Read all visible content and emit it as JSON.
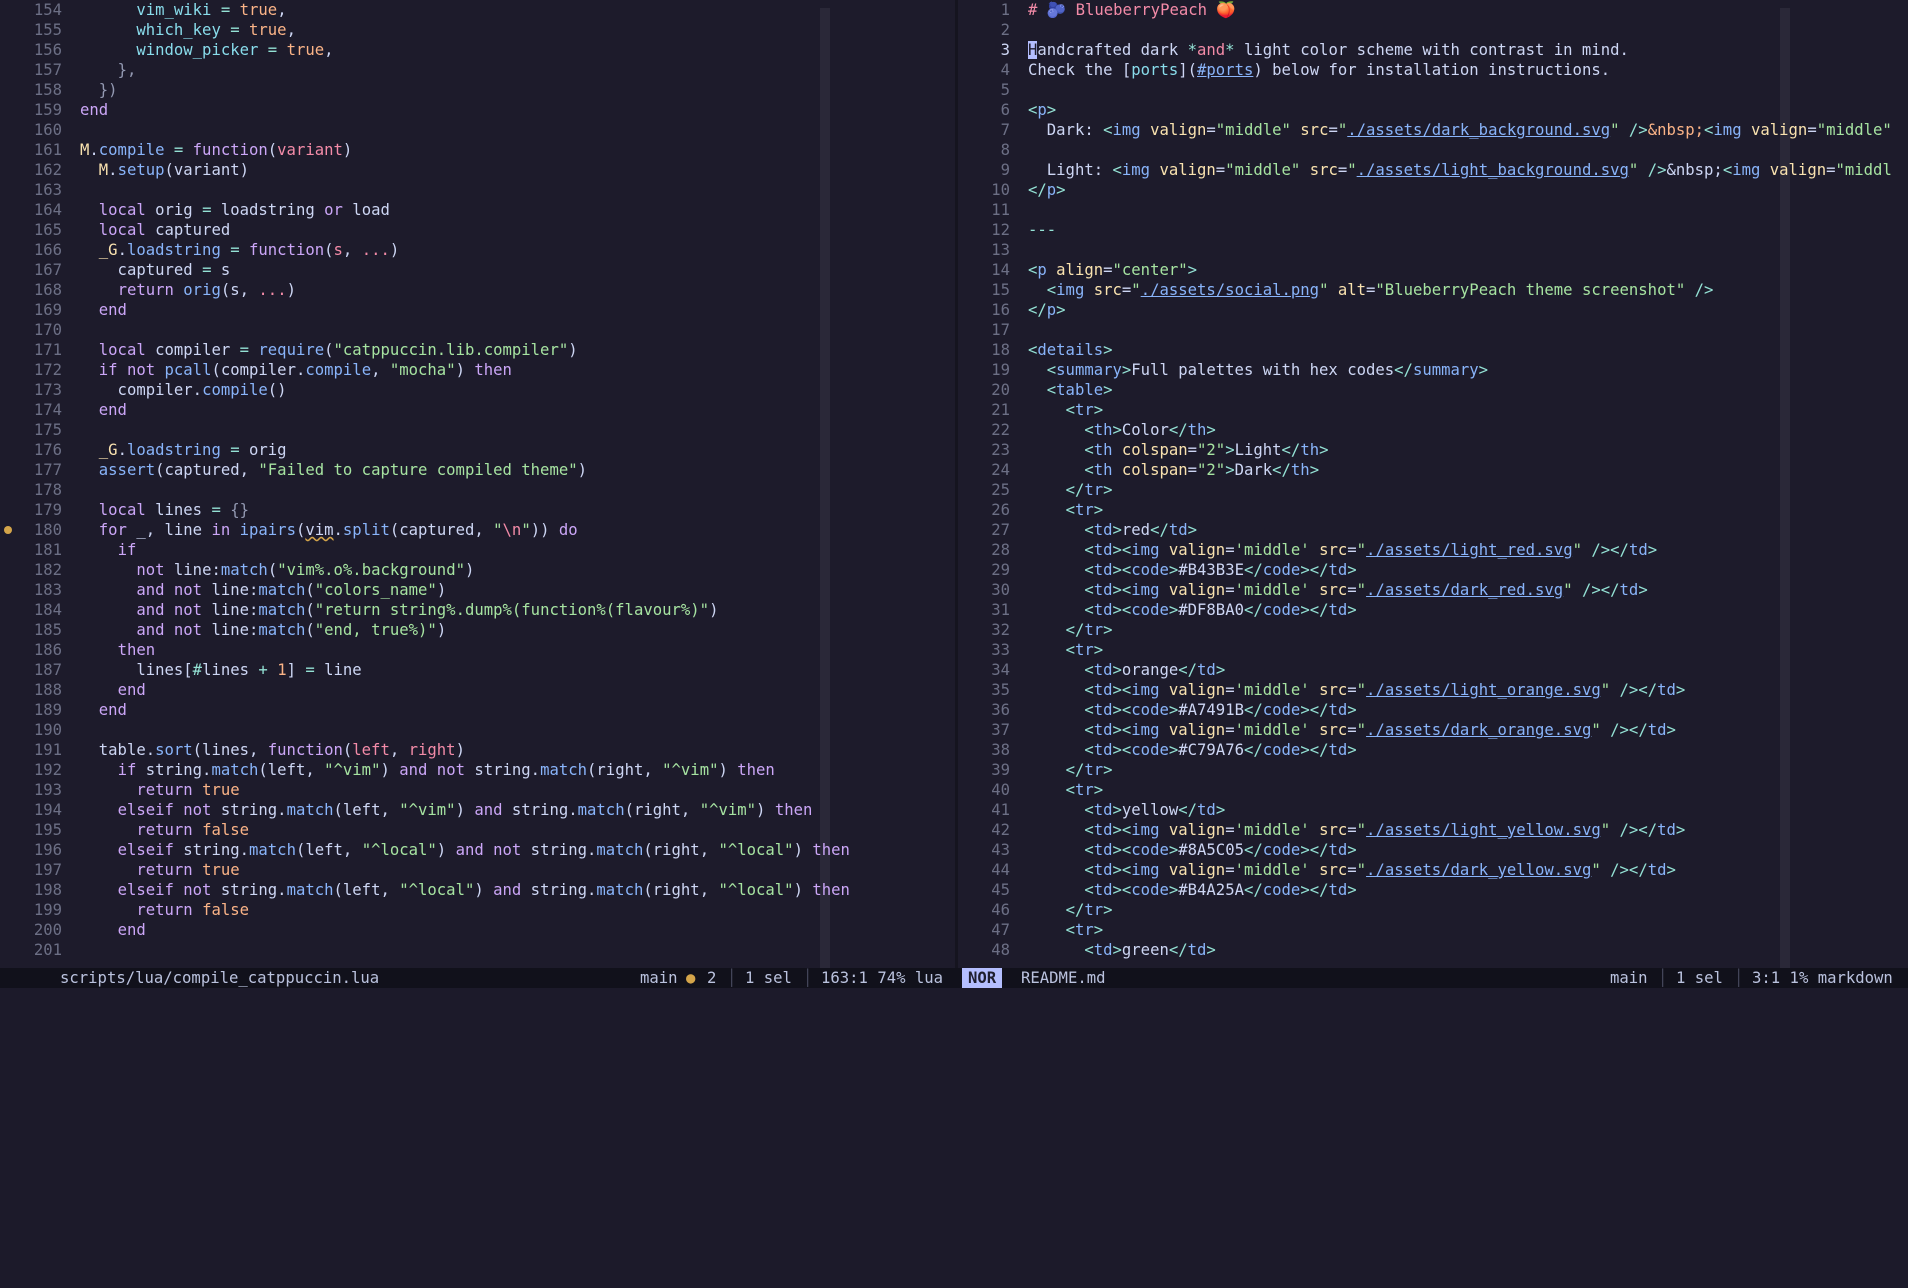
{
  "left": {
    "lines": [
      {
        "n": "154",
        "html": "      <span class='t'>vim_wiki</span> <span class='c'>=</span> <span class='n'>true</span>,"
      },
      {
        "n": "155",
        "html": "      <span class='t'>which_key</span> <span class='c'>=</span> <span class='n'>true</span>,"
      },
      {
        "n": "156",
        "html": "      <span class='t'>window_picker</span> <span class='c'>=</span> <span class='n'>true</span>,"
      },
      {
        "n": "157",
        "html": "    <span class='g'>},</span>"
      },
      {
        "n": "158",
        "html": "  <span class='g'>})</span>"
      },
      {
        "n": "159",
        "html": "<span class='k'>end</span>"
      },
      {
        "n": "160",
        "html": ""
      },
      {
        "n": "161",
        "html": "<span class='m'>M</span>.<span class='f'>compile</span> <span class='c'>=</span> <span class='k'>function</span>(<span class='p'>variant</span>)"
      },
      {
        "n": "162",
        "html": "  <span class='m'>M</span>.<span class='f'>setup</span>(variant)"
      },
      {
        "n": "163",
        "html": ""
      },
      {
        "n": "164",
        "html": "  <span class='k'>local</span> orig <span class='c'>=</span> loadstring <span class='k'>or</span> load"
      },
      {
        "n": "165",
        "html": "  <span class='k'>local</span> captured"
      },
      {
        "n": "166",
        "html": "  <span class='m'>_G</span>.<span class='f'>loadstring</span> <span class='c'>=</span> <span class='k'>function</span>(<span class='p'>s</span>, <span class='p'>...</span>)"
      },
      {
        "n": "167",
        "html": "    captured <span class='c'>=</span> s"
      },
      {
        "n": "168",
        "html": "    <span class='k'>return</span> <span class='f'>orig</span>(s, <span class='p'>...</span>)"
      },
      {
        "n": "169",
        "html": "  <span class='k'>end</span>"
      },
      {
        "n": "170",
        "html": ""
      },
      {
        "n": "171",
        "html": "  <span class='k'>local</span> compiler <span class='c'>=</span> <span class='f'>require</span>(<span class='s'>\"catppuccin.lib.compiler\"</span>)"
      },
      {
        "n": "172",
        "html": "  <span class='k'>if not</span> <span class='f'>pcall</span>(compiler.<span class='f'>compile</span>, <span class='s'>\"mocha\"</span>) <span class='k'>then</span>"
      },
      {
        "n": "173",
        "html": "    compiler.<span class='f'>compile</span>()"
      },
      {
        "n": "174",
        "html": "  <span class='k'>end</span>"
      },
      {
        "n": "175",
        "html": ""
      },
      {
        "n": "176",
        "html": "  <span class='m'>_G</span>.<span class='f'>loadstring</span> <span class='c'>=</span> orig"
      },
      {
        "n": "177",
        "html": "  <span class='f'>assert</span>(captured, <span class='s'>\"Failed to capture compiled theme\"</span>)"
      },
      {
        "n": "178",
        "html": ""
      },
      {
        "n": "179",
        "html": "  <span class='k'>local</span> lines <span class='c'>=</span> <span class='g'>{}</span>"
      },
      {
        "n": "180",
        "html": "  <span class='k'>for</span> _, line <span class='k'>in</span> <span class='f'>ipairs</span>(<span class='und'>vim</span>.<span class='f'>split</span>(captured, <span class='s'>\"<span class='p'>\\n</span>\"</span>)) <span class='k'>do</span>",
        "marker": true
      },
      {
        "n": "181",
        "html": "    <span class='k'>if</span>"
      },
      {
        "n": "182",
        "html": "      <span class='k'>not</span> line:<span class='f'>match</span>(<span class='s'>\"vim%.o%.background\"</span>)"
      },
      {
        "n": "183",
        "html": "      <span class='k'>and not</span> line:<span class='f'>match</span>(<span class='s'>\"colors_name\"</span>)"
      },
      {
        "n": "184",
        "html": "      <span class='k'>and not</span> line:<span class='f'>match</span>(<span class='s'>\"return string%.dump%(function%(flavour%)\"</span>)"
      },
      {
        "n": "185",
        "html": "      <span class='k'>and not</span> line:<span class='f'>match</span>(<span class='s'>\"end, true%)\"</span>)"
      },
      {
        "n": "186",
        "html": "    <span class='k'>then</span>"
      },
      {
        "n": "187",
        "html": "      lines[<span class='c'>#</span>lines <span class='c'>+</span> <span class='n'>1</span>] <span class='c'>=</span> line"
      },
      {
        "n": "188",
        "html": "    <span class='k'>end</span>"
      },
      {
        "n": "189",
        "html": "  <span class='k'>end</span>"
      },
      {
        "n": "190",
        "html": ""
      },
      {
        "n": "191",
        "html": "  table.<span class='f'>sort</span>(lines, <span class='k'>function</span>(<span class='p'>left</span>, <span class='p'>right</span>)"
      },
      {
        "n": "192",
        "html": "    <span class='k'>if</span> string.<span class='f'>match</span>(left, <span class='s'>\"^vim\"</span>) <span class='k'>and not</span> string.<span class='f'>match</span>(right, <span class='s'>\"^vim\"</span>) <span class='k'>then</span>"
      },
      {
        "n": "193",
        "html": "      <span class='k'>return</span> <span class='n'>true</span>"
      },
      {
        "n": "194",
        "html": "    <span class='k'>elseif not</span> string.<span class='f'>match</span>(left, <span class='s'>\"^vim\"</span>) <span class='k'>and</span> string.<span class='f'>match</span>(right, <span class='s'>\"^vim\"</span>) <span class='k'>then</span>"
      },
      {
        "n": "195",
        "html": "      <span class='k'>return</span> <span class='n'>false</span>"
      },
      {
        "n": "196",
        "html": "    <span class='k'>elseif</span> string.<span class='f'>match</span>(left, <span class='s'>\"^local\"</span>) <span class='k'>and not</span> string.<span class='f'>match</span>(right, <span class='s'>\"^local\"</span>) <span class='k'>then</span>"
      },
      {
        "n": "197",
        "html": "      <span class='k'>return</span> <span class='n'>true</span>"
      },
      {
        "n": "198",
        "html": "    <span class='k'>elseif not</span> string.<span class='f'>match</span>(left, <span class='s'>\"^local\"</span>) <span class='k'>and</span> string.<span class='f'>match</span>(right, <span class='s'>\"^local\"</span>) <span class='k'>then</span>"
      },
      {
        "n": "199",
        "html": "      <span class='k'>return</span> <span class='n'>false</span>"
      },
      {
        "n": "200",
        "html": "    <span class='k'>end</span>"
      },
      {
        "n": "201",
        "html": ""
      }
    ]
  },
  "right": {
    "lines": [
      {
        "n": "1",
        "html": "<span class='h'># 🫐 BlueberryPeach 🍑</span>"
      },
      {
        "n": "2",
        "html": ""
      },
      {
        "n": "3",
        "html": "<span class='cursor'>H</span>andcrafted dark <span class='c'>*</span><span class='p'>and</span><span class='c'>*</span> light color scheme with contrast in mind.",
        "cur": true
      },
      {
        "n": "4",
        "html": "Check the [<span class='t'>ports</span>](<span class='u'>#ports</span>) below for installation instructions."
      },
      {
        "n": "5",
        "html": ""
      },
      {
        "n": "6",
        "html": "<span class='c'>&lt;</span><span class='f'>p</span><span class='c'>&gt;</span>"
      },
      {
        "n": "7",
        "html": "  Dark: <span class='c'>&lt;</span><span class='f'>img</span> <span class='m'>valign</span>=<span class='s'>\"middle\"</span> <span class='m'>src</span>=<span class='s'>\"</span><span class='u'>./assets/dark_background.svg</span><span class='s'>\"</span> <span class='c'>/&gt;</span><span class='n'>&amp;nbsp;</span><span class='c'>&lt;</span><span class='f'>img</span> <span class='m'>valign</span>=<span class='s'>\"middle\"</span>"
      },
      {
        "n": "8",
        "html": ""
      },
      {
        "n": "9",
        "html": "  Light: <span class='c'>&lt;</span><span class='f'>img</span> <span class='m'>valign</span>=<span class='s'>\"middle\"</span> <span class='m'>src</span>=<span class='s'>\"</span><span class='u'>./assets/light_background.svg</span><span class='s'>\"</span> <span class='c'>/&gt;</span>&amp;nbsp;<span class='c'>&lt;</span><span class='f'>img</span> <span class='m'>valign</span>=<span class='s'>\"middl</span>"
      },
      {
        "n": "10",
        "html": "<span class='c'>&lt;/</span><span class='f'>p</span><span class='c'>&gt;</span>"
      },
      {
        "n": "11",
        "html": ""
      },
      {
        "n": "12",
        "html": "<span class='c'>---</span>"
      },
      {
        "n": "13",
        "html": ""
      },
      {
        "n": "14",
        "html": "<span class='c'>&lt;</span><span class='f'>p</span> <span class='m'>align</span>=<span class='s'>\"center\"</span><span class='c'>&gt;</span>"
      },
      {
        "n": "15",
        "html": "  <span class='c'>&lt;</span><span class='f'>img</span> <span class='m'>src</span>=<span class='s'>\"</span><span class='u'>./assets/social.png</span><span class='s'>\"</span> <span class='m'>alt</span>=<span class='s'>\"BlueberryPeach theme screenshot\"</span> <span class='c'>/&gt;</span>"
      },
      {
        "n": "16",
        "html": "<span class='c'>&lt;/</span><span class='f'>p</span><span class='c'>&gt;</span>"
      },
      {
        "n": "17",
        "html": ""
      },
      {
        "n": "18",
        "html": "<span class='c'>&lt;</span><span class='f'>details</span><span class='c'>&gt;</span>"
      },
      {
        "n": "19",
        "html": "  <span class='c'>&lt;</span><span class='f'>summary</span><span class='c'>&gt;</span>Full palettes with hex codes<span class='c'>&lt;/</span><span class='f'>summary</span><span class='c'>&gt;</span>"
      },
      {
        "n": "20",
        "html": "  <span class='c'>&lt;</span><span class='f'>table</span><span class='c'>&gt;</span>"
      },
      {
        "n": "21",
        "html": "    <span class='c'>&lt;</span><span class='f'>tr</span><span class='c'>&gt;</span>"
      },
      {
        "n": "22",
        "html": "      <span class='c'>&lt;</span><span class='f'>th</span><span class='c'>&gt;</span>Color<span class='c'>&lt;/</span><span class='f'>th</span><span class='c'>&gt;</span>"
      },
      {
        "n": "23",
        "html": "      <span class='c'>&lt;</span><span class='f'>th</span> <span class='m'>colspan</span>=<span class='s'>\"2\"</span><span class='c'>&gt;</span>Light<span class='c'>&lt;/</span><span class='f'>th</span><span class='c'>&gt;</span>"
      },
      {
        "n": "24",
        "html": "      <span class='c'>&lt;</span><span class='f'>th</span> <span class='m'>colspan</span>=<span class='s'>\"2\"</span><span class='c'>&gt;</span>Dark<span class='c'>&lt;/</span><span class='f'>th</span><span class='c'>&gt;</span>"
      },
      {
        "n": "25",
        "html": "    <span class='c'>&lt;/</span><span class='f'>tr</span><span class='c'>&gt;</span>"
      },
      {
        "n": "26",
        "html": "    <span class='c'>&lt;</span><span class='f'>tr</span><span class='c'>&gt;</span>"
      },
      {
        "n": "27",
        "html": "      <span class='c'>&lt;</span><span class='f'>td</span><span class='c'>&gt;</span>red<span class='c'>&lt;/</span><span class='f'>td</span><span class='c'>&gt;</span>"
      },
      {
        "n": "28",
        "html": "      <span class='c'>&lt;</span><span class='f'>td</span><span class='c'>&gt;&lt;</span><span class='f'>img</span> <span class='m'>valign</span>=<span class='s'>'middle'</span> <span class='m'>src</span>=<span class='s'>\"</span><span class='u'>./assets/light_red.svg</span><span class='s'>\"</span> <span class='c'>/&gt;&lt;/</span><span class='f'>td</span><span class='c'>&gt;</span>"
      },
      {
        "n": "29",
        "html": "      <span class='c'>&lt;</span><span class='f'>td</span><span class='c'>&gt;&lt;</span><span class='f'>code</span><span class='c'>&gt;</span>#B43B3E<span class='c'>&lt;/</span><span class='f'>code</span><span class='c'>&gt;&lt;/</span><span class='f'>td</span><span class='c'>&gt;</span>"
      },
      {
        "n": "30",
        "html": "      <span class='c'>&lt;</span><span class='f'>td</span><span class='c'>&gt;&lt;</span><span class='f'>img</span> <span class='m'>valign</span>=<span class='s'>'middle'</span> <span class='m'>src</span>=<span class='s'>\"</span><span class='u'>./assets/dark_red.svg</span><span class='s'>\"</span> <span class='c'>/&gt;&lt;/</span><span class='f'>td</span><span class='c'>&gt;</span>"
      },
      {
        "n": "31",
        "html": "      <span class='c'>&lt;</span><span class='f'>td</span><span class='c'>&gt;&lt;</span><span class='f'>code</span><span class='c'>&gt;</span>#DF8BA0<span class='c'>&lt;/</span><span class='f'>code</span><span class='c'>&gt;&lt;/</span><span class='f'>td</span><span class='c'>&gt;</span>"
      },
      {
        "n": "32",
        "html": "    <span class='c'>&lt;/</span><span class='f'>tr</span><span class='c'>&gt;</span>"
      },
      {
        "n": "33",
        "html": "    <span class='c'>&lt;</span><span class='f'>tr</span><span class='c'>&gt;</span>"
      },
      {
        "n": "34",
        "html": "      <span class='c'>&lt;</span><span class='f'>td</span><span class='c'>&gt;</span>orange<span class='c'>&lt;/</span><span class='f'>td</span><span class='c'>&gt;</span>"
      },
      {
        "n": "35",
        "html": "      <span class='c'>&lt;</span><span class='f'>td</span><span class='c'>&gt;&lt;</span><span class='f'>img</span> <span class='m'>valign</span>=<span class='s'>'middle'</span> <span class='m'>src</span>=<span class='s'>\"</span><span class='u'>./assets/light_orange.svg</span><span class='s'>\"</span> <span class='c'>/&gt;&lt;/</span><span class='f'>td</span><span class='c'>&gt;</span>"
      },
      {
        "n": "36",
        "html": "      <span class='c'>&lt;</span><span class='f'>td</span><span class='c'>&gt;&lt;</span><span class='f'>code</span><span class='c'>&gt;</span>#A7491B<span class='c'>&lt;/</span><span class='f'>code</span><span class='c'>&gt;&lt;/</span><span class='f'>td</span><span class='c'>&gt;</span>"
      },
      {
        "n": "37",
        "html": "      <span class='c'>&lt;</span><span class='f'>td</span><span class='c'>&gt;&lt;</span><span class='f'>img</span> <span class='m'>valign</span>=<span class='s'>'middle'</span> <span class='m'>src</span>=<span class='s'>\"</span><span class='u'>./assets/dark_orange.svg</span><span class='s'>\"</span> <span class='c'>/&gt;&lt;/</span><span class='f'>td</span><span class='c'>&gt;</span>"
      },
      {
        "n": "38",
        "html": "      <span class='c'>&lt;</span><span class='f'>td</span><span class='c'>&gt;&lt;</span><span class='f'>code</span><span class='c'>&gt;</span>#C79A76<span class='c'>&lt;/</span><span class='f'>code</span><span class='c'>&gt;&lt;/</span><span class='f'>td</span><span class='c'>&gt;</span>"
      },
      {
        "n": "39",
        "html": "    <span class='c'>&lt;/</span><span class='f'>tr</span><span class='c'>&gt;</span>"
      },
      {
        "n": "40",
        "html": "    <span class='c'>&lt;</span><span class='f'>tr</span><span class='c'>&gt;</span>"
      },
      {
        "n": "41",
        "html": "      <span class='c'>&lt;</span><span class='f'>td</span><span class='c'>&gt;</span>yellow<span class='c'>&lt;/</span><span class='f'>td</span><span class='c'>&gt;</span>"
      },
      {
        "n": "42",
        "html": "      <span class='c'>&lt;</span><span class='f'>td</span><span class='c'>&gt;&lt;</span><span class='f'>img</span> <span class='m'>valign</span>=<span class='s'>'middle'</span> <span class='m'>src</span>=<span class='s'>\"</span><span class='u'>./assets/light_yellow.svg</span><span class='s'>\"</span> <span class='c'>/&gt;&lt;/</span><span class='f'>td</span><span class='c'>&gt;</span>"
      },
      {
        "n": "43",
        "html": "      <span class='c'>&lt;</span><span class='f'>td</span><span class='c'>&gt;&lt;</span><span class='f'>code</span><span class='c'>&gt;</span>#8A5C05<span class='c'>&lt;/</span><span class='f'>code</span><span class='c'>&gt;&lt;/</span><span class='f'>td</span><span class='c'>&gt;</span>"
      },
      {
        "n": "44",
        "html": "      <span class='c'>&lt;</span><span class='f'>td</span><span class='c'>&gt;&lt;</span><span class='f'>img</span> <span class='m'>valign</span>=<span class='s'>'middle'</span> <span class='m'>src</span>=<span class='s'>\"</span><span class='u'>./assets/dark_yellow.svg</span><span class='s'>\"</span> <span class='c'>/&gt;&lt;/</span><span class='f'>td</span><span class='c'>&gt;</span>"
      },
      {
        "n": "45",
        "html": "      <span class='c'>&lt;</span><span class='f'>td</span><span class='c'>&gt;&lt;</span><span class='f'>code</span><span class='c'>&gt;</span>#B4A25A<span class='c'>&lt;/</span><span class='f'>code</span><span class='c'>&gt;&lt;/</span><span class='f'>td</span><span class='c'>&gt;</span>"
      },
      {
        "n": "46",
        "html": "    <span class='c'>&lt;/</span><span class='f'>tr</span><span class='c'>&gt;</span>"
      },
      {
        "n": "47",
        "html": "    <span class='c'>&lt;</span><span class='f'>tr</span><span class='c'>&gt;</span>"
      },
      {
        "n": "48",
        "html": "      <span class='c'>&lt;</span><span class='f'>td</span><span class='c'>&gt;</span>green<span class='c'>&lt;/</span><span class='f'>td</span><span class='c'>&gt;</span>"
      }
    ]
  },
  "statusline": {
    "left_file": "scripts/lua/compile_catppuccin.lua",
    "left_branch": "main",
    "left_dot": "●",
    "left_count": "2",
    "left_sel": "1 sel",
    "left_pos": "163:1 74% lua",
    "mode": "NOR",
    "right_file": "README.md",
    "right_branch": "main",
    "right_sel": "1 sel",
    "right_pos": "3:1 1% markdown",
    "sep": "│"
  },
  "colors": {
    "background": "#1d1b2b",
    "mode_bg": "#b4befe",
    "marker": "#d4a54a"
  }
}
